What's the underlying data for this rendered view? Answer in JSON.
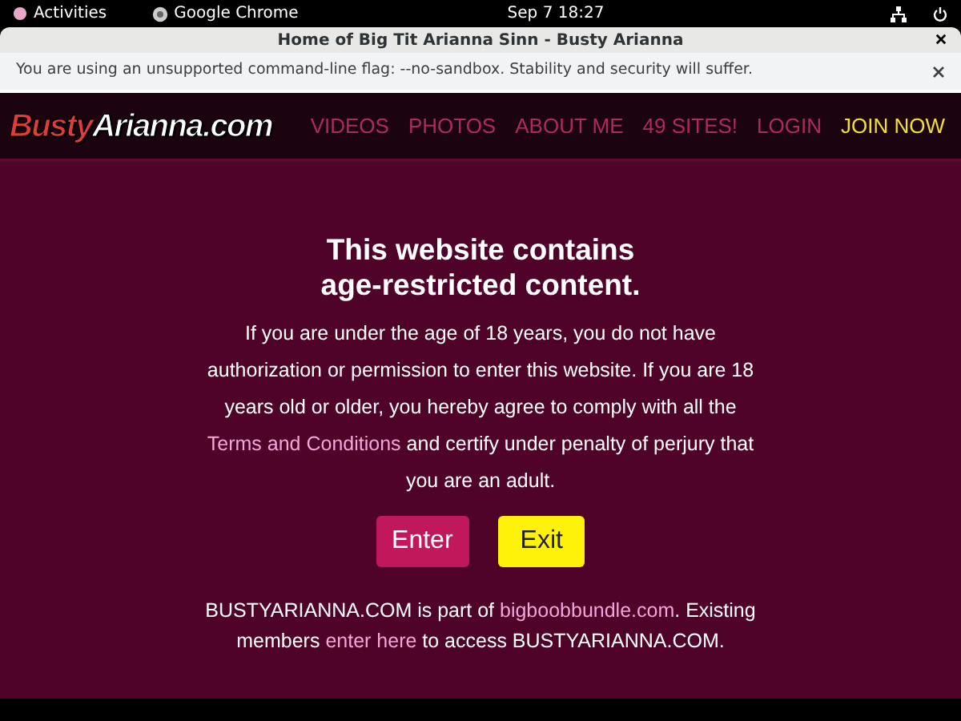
{
  "system_bar": {
    "activities": "Activities",
    "app": "Google Chrome",
    "clock": "Sep 7  18:27"
  },
  "window": {
    "title": "Home of Big Tit Arianna Sinn - Busty Arianna"
  },
  "infobar": {
    "message": "You are using an unsupported command-line flag: --no-sandbox. Stability and security will suffer."
  },
  "site": {
    "logo": [
      "Busty",
      "Arianna.com"
    ],
    "nav": [
      {
        "label": "VIDEOS",
        "kind": "link"
      },
      {
        "label": "PHOTOS",
        "kind": "link"
      },
      {
        "label": "ABOUT ME",
        "kind": "link"
      },
      {
        "label": "49 SITES!",
        "kind": "link"
      },
      {
        "label": "LOGIN",
        "kind": "link"
      },
      {
        "label": "JOIN NOW",
        "kind": "join"
      }
    ]
  },
  "notice": {
    "heading": [
      "This website contains",
      "age-restricted content."
    ],
    "body": [
      {
        "kind": "text",
        "text": "If you are under the age of 18 years, you do not have authorization or permission to enter this website. If you are 18 years old or older, you hereby agree to comply with all the "
      },
      {
        "kind": "link",
        "text": "Terms and Conditions"
      },
      {
        "kind": "text",
        "text": " and certify under penalty of perjury that you are an adult."
      }
    ],
    "buttons": [
      {
        "label": "Enter",
        "kind": "enter"
      },
      {
        "label": "Exit",
        "kind": "exit"
      }
    ],
    "footer": [
      {
        "kind": "text",
        "text": "BUSTYARIANNA.COM is part of "
      },
      {
        "kind": "link",
        "text": "bigboobbundle.com"
      },
      {
        "kind": "text",
        "text": ". Existing members "
      },
      {
        "kind": "link",
        "text": "enter here"
      },
      {
        "kind": "text",
        "text": " to access BUSTYARIANNA.COM."
      }
    ]
  }
}
